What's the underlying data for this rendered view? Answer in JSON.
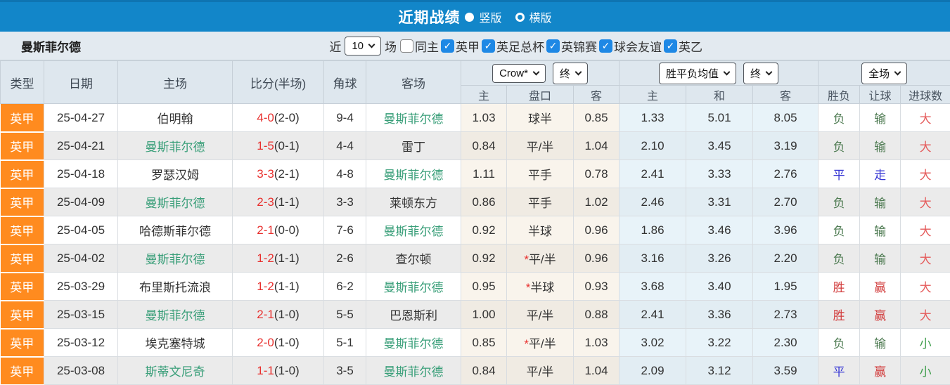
{
  "titlebar": {
    "title": "近期战绩",
    "radios": [
      {
        "label": "竖版",
        "selected": true
      },
      {
        "label": "横版",
        "selected": false
      }
    ]
  },
  "filterbar": {
    "team": "曼斯菲尔德",
    "recent_label": "近",
    "recent_value": "10",
    "recent_suffix": "场",
    "checkboxes": [
      {
        "label": "同主",
        "checked": false
      },
      {
        "label": "英甲",
        "checked": true
      },
      {
        "label": "英足总杯",
        "checked": true
      },
      {
        "label": "英锦赛",
        "checked": true
      },
      {
        "label": "球会友谊",
        "checked": true
      },
      {
        "label": "英乙",
        "checked": true
      }
    ]
  },
  "table": {
    "left_headers": [
      "类型",
      "日期",
      "主场",
      "比分(半场)",
      "角球",
      "客场"
    ],
    "sub_headers": [
      "主",
      "盘口",
      "客",
      "主",
      "和",
      "客",
      "胜负",
      "让球",
      "进球数"
    ],
    "controls": {
      "odds_company": "Crow*",
      "odds_stage": "终",
      "avg_label": "胜平负均值",
      "avg_stage": "终",
      "scope": "全场"
    },
    "rows": [
      {
        "league": "英甲",
        "date": "25-04-27",
        "home": "伯明翰",
        "home_hl": false,
        "score": "4-0",
        "half": "(2-0)",
        "corners": "9-4",
        "away": "曼斯菲尔德",
        "away_hl": true,
        "odds_home": "1.03",
        "handicap": "球半",
        "star": false,
        "odds_away": "0.85",
        "avg_win": "1.33",
        "avg_draw": "5.01",
        "avg_lose": "8.05",
        "result": "负",
        "result_t": "lose",
        "let": "输",
        "let_t": "lose",
        "goal": "大",
        "goal_t": "big"
      },
      {
        "league": "英甲",
        "date": "25-04-21",
        "home": "曼斯菲尔德",
        "home_hl": true,
        "score": "1-5",
        "half": "(0-1)",
        "corners": "4-4",
        "away": "雷丁",
        "away_hl": false,
        "odds_home": "0.84",
        "handicap": "平/半",
        "star": false,
        "odds_away": "1.04",
        "avg_win": "2.10",
        "avg_draw": "3.45",
        "avg_lose": "3.19",
        "result": "负",
        "result_t": "lose",
        "let": "输",
        "let_t": "lose",
        "goal": "大",
        "goal_t": "big"
      },
      {
        "league": "英甲",
        "date": "25-04-18",
        "home": "罗瑟汉姆",
        "home_hl": false,
        "score": "3-3",
        "half": "(2-1)",
        "corners": "4-8",
        "away": "曼斯菲尔德",
        "away_hl": true,
        "odds_home": "1.11",
        "handicap": "平手",
        "star": false,
        "odds_away": "0.78",
        "avg_win": "2.41",
        "avg_draw": "3.33",
        "avg_lose": "2.76",
        "result": "平",
        "result_t": "draw",
        "let": "走",
        "let_t": "draw",
        "goal": "大",
        "goal_t": "big"
      },
      {
        "league": "英甲",
        "date": "25-04-09",
        "home": "曼斯菲尔德",
        "home_hl": true,
        "score": "2-3",
        "half": "(1-1)",
        "corners": "3-3",
        "away": "莱顿东方",
        "away_hl": false,
        "odds_home": "0.86",
        "handicap": "平手",
        "star": false,
        "odds_away": "1.02",
        "avg_win": "2.46",
        "avg_draw": "3.31",
        "avg_lose": "2.70",
        "result": "负",
        "result_t": "lose",
        "let": "输",
        "let_t": "lose",
        "goal": "大",
        "goal_t": "big"
      },
      {
        "league": "英甲",
        "date": "25-04-05",
        "home": "哈德斯菲尔德",
        "home_hl": false,
        "score": "2-1",
        "half": "(0-0)",
        "corners": "7-6",
        "away": "曼斯菲尔德",
        "away_hl": true,
        "odds_home": "0.92",
        "handicap": "半球",
        "star": false,
        "odds_away": "0.96",
        "avg_win": "1.86",
        "avg_draw": "3.46",
        "avg_lose": "3.96",
        "result": "负",
        "result_t": "lose",
        "let": "输",
        "let_t": "lose",
        "goal": "大",
        "goal_t": "big"
      },
      {
        "league": "英甲",
        "date": "25-04-02",
        "home": "曼斯菲尔德",
        "home_hl": true,
        "score": "1-2",
        "half": "(1-1)",
        "corners": "2-6",
        "away": "查尔顿",
        "away_hl": false,
        "odds_home": "0.92",
        "handicap": "平/半",
        "star": true,
        "odds_away": "0.96",
        "avg_win": "3.16",
        "avg_draw": "3.26",
        "avg_lose": "2.20",
        "result": "负",
        "result_t": "lose",
        "let": "输",
        "let_t": "lose",
        "goal": "大",
        "goal_t": "big"
      },
      {
        "league": "英甲",
        "date": "25-03-29",
        "home": "布里斯托流浪",
        "home_hl": false,
        "score": "1-2",
        "half": "(1-1)",
        "corners": "6-2",
        "away": "曼斯菲尔德",
        "away_hl": true,
        "odds_home": "0.95",
        "handicap": "半球",
        "star": true,
        "odds_away": "0.93",
        "avg_win": "3.68",
        "avg_draw": "3.40",
        "avg_lose": "1.95",
        "result": "胜",
        "result_t": "win",
        "let": "赢",
        "let_t": "win",
        "goal": "大",
        "goal_t": "big"
      },
      {
        "league": "英甲",
        "date": "25-03-15",
        "home": "曼斯菲尔德",
        "home_hl": true,
        "score": "2-1",
        "half": "(1-0)",
        "corners": "5-5",
        "away": "巴恩斯利",
        "away_hl": false,
        "odds_home": "1.00",
        "handicap": "平/半",
        "star": false,
        "odds_away": "0.88",
        "avg_win": "2.41",
        "avg_draw": "3.36",
        "avg_lose": "2.73",
        "result": "胜",
        "result_t": "win",
        "let": "赢",
        "let_t": "win",
        "goal": "大",
        "goal_t": "big"
      },
      {
        "league": "英甲",
        "date": "25-03-12",
        "home": "埃克塞特城",
        "home_hl": false,
        "score": "2-0",
        "half": "(1-0)",
        "corners": "5-1",
        "away": "曼斯菲尔德",
        "away_hl": true,
        "odds_home": "0.85",
        "handicap": "平/半",
        "star": true,
        "odds_away": "1.03",
        "avg_win": "3.02",
        "avg_draw": "3.22",
        "avg_lose": "2.30",
        "result": "负",
        "result_t": "lose",
        "let": "输",
        "let_t": "lose",
        "goal": "小",
        "goal_t": "small"
      },
      {
        "league": "英甲",
        "date": "25-03-08",
        "home": "斯蒂文尼奇",
        "home_hl": true,
        "score": "1-1",
        "half": "(1-0)",
        "corners": "3-5",
        "away": "曼斯菲尔德",
        "away_hl": true,
        "odds_home": "0.84",
        "handicap": "平/半",
        "star": false,
        "odds_away": "1.04",
        "avg_win": "2.09",
        "avg_draw": "3.12",
        "avg_lose": "3.59",
        "result": "平",
        "result_t": "draw",
        "let": "赢",
        "let_t": "win",
        "goal": "小",
        "goal_t": "small"
      }
    ]
  },
  "colors": {
    "titlebar_blue": "#1286c9",
    "league_orange": "#ff8b1f",
    "team_green": "#389e78",
    "score_red": "#e8302e",
    "win_red": "#d23c3c",
    "lose_green": "#4e7b52",
    "draw_blue": "#3535d4",
    "big_red": "#e55b5b",
    "small_green": "#3f9e4c",
    "checkbox_blue": "#1e88e5"
  }
}
